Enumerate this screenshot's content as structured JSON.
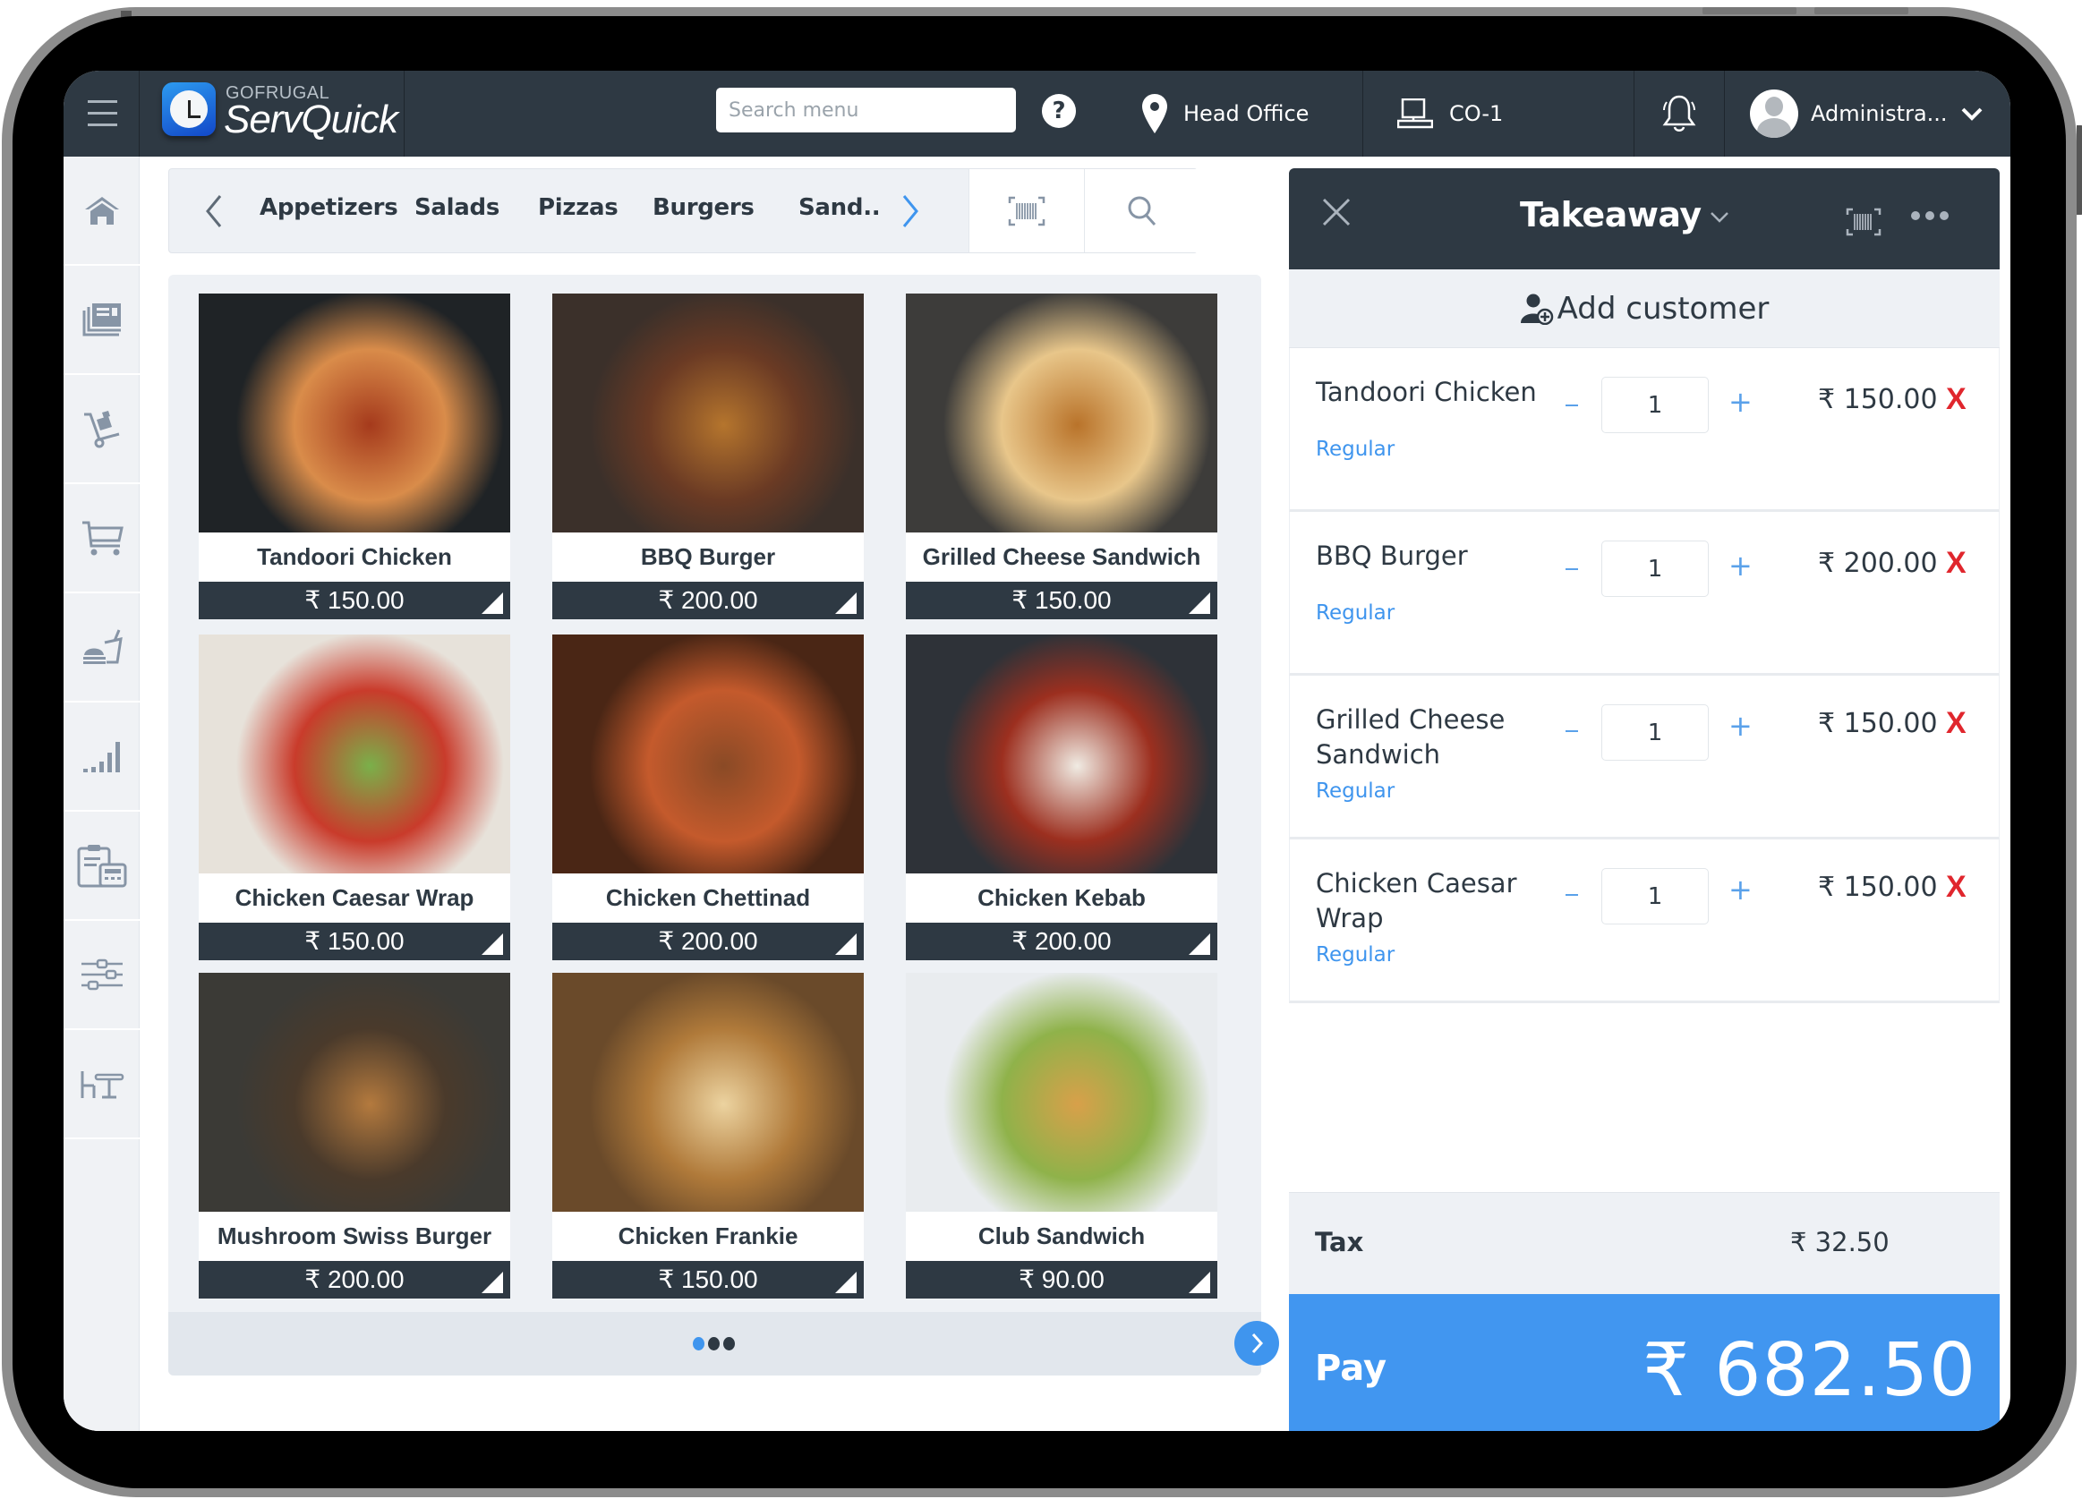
{
  "app": {
    "brand": "GOFRUGAL",
    "product": "ServQuick"
  },
  "header": {
    "search_placeholder": "Search menu",
    "help_icon": "?",
    "location": "Head Office",
    "counter": "CO-1",
    "user": "Administra..."
  },
  "sidebar": {
    "items": [
      {
        "icon": "home-icon"
      },
      {
        "icon": "orders-icon"
      },
      {
        "icon": "delivery-trolley-icon"
      },
      {
        "icon": "cart-icon"
      },
      {
        "icon": "food-drink-icon"
      },
      {
        "icon": "reports-icon"
      },
      {
        "icon": "billing-icon"
      },
      {
        "icon": "settings-sliders-icon"
      },
      {
        "icon": "table-icon"
      }
    ]
  },
  "categories": {
    "items": [
      "Appetizers",
      "Salads",
      "Pizzas",
      "Burgers",
      "Sand.."
    ]
  },
  "products": [
    {
      "name": "Tandoori Chicken",
      "price": "₹ 150.00",
      "colors": [
        "#1f2326",
        "#a53a1c",
        "#d98c4a"
      ]
    },
    {
      "name": "BBQ Burger",
      "price": "₹ 200.00",
      "colors": [
        "#3b302a",
        "#b5752d",
        "#6a3a24"
      ]
    },
    {
      "name": "Grilled Cheese Sandwich",
      "price": "₹ 150.00",
      "colors": [
        "#3d3c3a",
        "#b9732a",
        "#e8c68a"
      ]
    },
    {
      "name": "Chicken Caesar Wrap",
      "price": "₹ 150.00",
      "colors": [
        "#e7e2da",
        "#7ab04a",
        "#c93b2b"
      ]
    },
    {
      "name": "Chicken Chettinad",
      "price": "₹ 200.00",
      "colors": [
        "#4a2615",
        "#8a4a26",
        "#c45a2c"
      ]
    },
    {
      "name": "Chicken Kebab",
      "price": "₹ 200.00",
      "colors": [
        "#2e3238",
        "#f0ebe3",
        "#9c2f1f"
      ]
    },
    {
      "name": "Mushroom Swiss Burger",
      "price": "₹ 200.00",
      "colors": [
        "#3b3a36",
        "#b47a3e",
        "#4a3a2b"
      ]
    },
    {
      "name": "Chicken Frankie",
      "price": "₹ 150.00",
      "colors": [
        "#6a4a2a",
        "#ecd3a0",
        "#b07a3a"
      ]
    },
    {
      "name": "Club Sandwich",
      "price": "₹ 90.00",
      "colors": [
        "#e9ecef",
        "#d8a04a",
        "#8fb24a"
      ]
    }
  ],
  "pagination": {
    "pages": 3,
    "current": 1
  },
  "cart": {
    "order_type": "Takeaway",
    "add_customer": "Add customer",
    "items": [
      {
        "name": "Tandoori Chicken",
        "variant": "Regular",
        "qty": "1",
        "price": "₹ 150.00"
      },
      {
        "name": "BBQ Burger",
        "variant": "Regular",
        "qty": "1",
        "price": "₹ 200.00"
      },
      {
        "name": "Grilled Cheese Sandwich",
        "variant": "Regular",
        "qty": "1",
        "price": "₹ 150.00"
      },
      {
        "name": "Chicken Caesar Wrap",
        "variant": "Regular",
        "qty": "1",
        "price": "₹ 150.00"
      }
    ],
    "minus": "–",
    "plus": "+",
    "remove": "X",
    "tax_label": "Tax",
    "tax_value": "₹ 32.50",
    "pay_label": "Pay",
    "pay_total": "₹ 682.50"
  },
  "colors": {
    "header_bg": "#2e3943",
    "accent_blue": "#4196f0",
    "remove_red": "#e0262d",
    "panel_bg": "#eef1f5"
  }
}
